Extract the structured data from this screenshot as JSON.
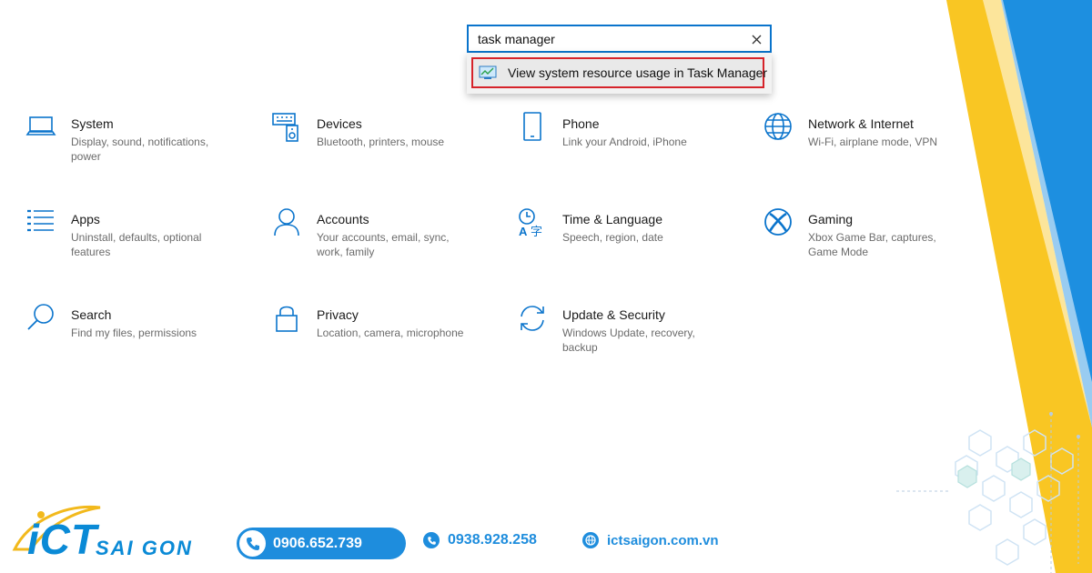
{
  "search": {
    "value": "task manager",
    "suggestion": "View system resource usage in Task Manager"
  },
  "tiles": [
    {
      "title": "System",
      "desc": "Display, sound, notifications, power",
      "icon": "laptop-icon"
    },
    {
      "title": "Devices",
      "desc": "Bluetooth, printers, mouse",
      "icon": "keyboard-speaker-icon"
    },
    {
      "title": "Phone",
      "desc": "Link your Android, iPhone",
      "icon": "phone-icon"
    },
    {
      "title": "Network & Internet",
      "desc": "Wi-Fi, airplane mode, VPN",
      "icon": "globe-icon"
    },
    {
      "title": "Apps",
      "desc": "Uninstall, defaults, optional features",
      "icon": "apps-list-icon"
    },
    {
      "title": "Accounts",
      "desc": "Your accounts, email, sync, work, family",
      "icon": "person-icon"
    },
    {
      "title": "Time & Language",
      "desc": "Speech, region, date",
      "icon": "time-language-icon"
    },
    {
      "title": "Gaming",
      "desc": "Xbox Game Bar, captures, Game Mode",
      "icon": "xbox-icon"
    },
    {
      "title": "Search",
      "desc": "Find my files, permissions",
      "icon": "search-icon"
    },
    {
      "title": "Privacy",
      "desc": "Location, camera, microphone",
      "icon": "lock-icon"
    },
    {
      "title": "Update & Security",
      "desc": "Windows Update, recovery, backup",
      "icon": "sync-icon"
    }
  ],
  "footer": {
    "logo_main": "iCT",
    "logo_sub": "SAI GON",
    "phone1": "0906.652.739",
    "phone2": "0938.928.258",
    "website": "ictsaigon.com.vn"
  },
  "colors": {
    "accent": "#0a74cc",
    "highlight_border": "#d6232a",
    "brand_blue": "#1e8ddd",
    "stripe_yellow": "#f9c623",
    "stripe_blue": "#1d8fe0"
  }
}
